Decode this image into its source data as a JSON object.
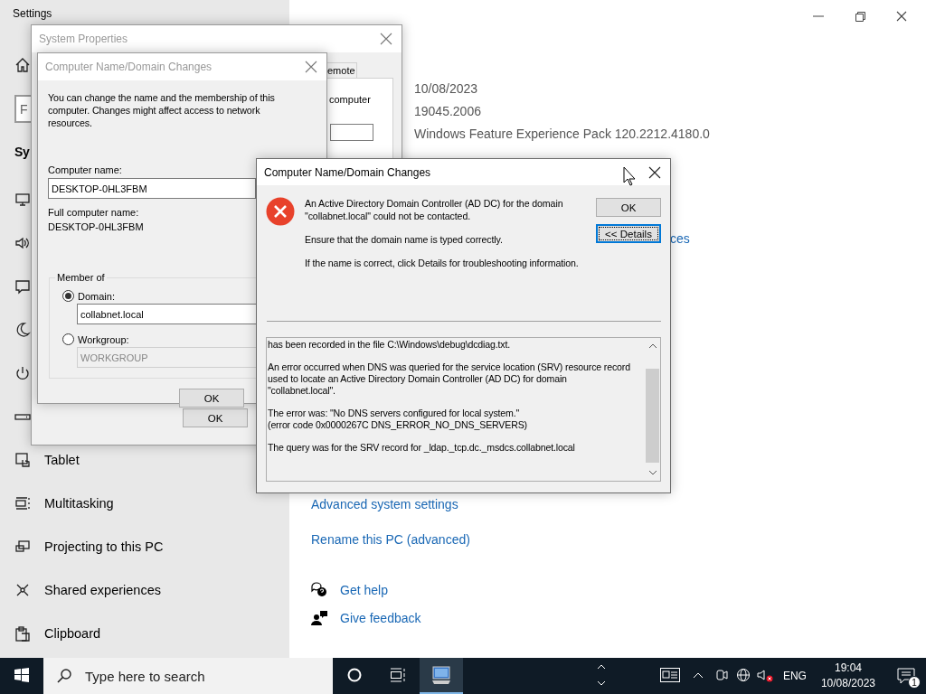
{
  "settings": {
    "title": "Settings"
  },
  "sidebar": {
    "search": {
      "placeholder": "F"
    },
    "heading": "Sy",
    "items": [
      {
        "kind": "display"
      },
      {
        "kind": "sound"
      },
      {
        "kind": "notifications"
      },
      {
        "kind": "focus"
      },
      {
        "kind": "power"
      },
      {
        "kind": "storage"
      },
      {
        "kind": "tablet",
        "label": "Tablet"
      },
      {
        "kind": "multitasking",
        "label": "Multitasking"
      },
      {
        "kind": "projecting",
        "label": "Projecting to this PC"
      },
      {
        "kind": "shared",
        "label": "Shared experiences"
      },
      {
        "kind": "clipboard",
        "label": "Clipboard"
      }
    ]
  },
  "about": {
    "values": [
      "10/08/2023",
      "19045.2006",
      "Windows Feature Experience Pack 120.2212.4180.0"
    ],
    "partial_link": "ces",
    "links": [
      "Advanced system settings",
      "Rename this PC (advanced)"
    ],
    "help": [
      {
        "kind": "help",
        "label": "Get help"
      },
      {
        "kind": "feedback",
        "label": "Give feedback"
      }
    ]
  },
  "system_properties": {
    "title": "System Properties",
    "active": false,
    "tab": "emote",
    "text": "computer",
    "button": "OK"
  },
  "name_dialog": {
    "title": "Computer Name/Domain Changes",
    "active": false,
    "intro": "You can change the name and the membership of this computer. Changes might affect access to network resources.",
    "computer_name_label": "Computer name:",
    "computer_name": "DESKTOP-0HL3FBM",
    "full_name_label": "Full computer name:",
    "full_name": "DESKTOP-0HL3FBM",
    "member_of": {
      "label": "Member of",
      "options": [
        {
          "label": "Domain:",
          "selected": true,
          "value": "collabnet.local",
          "disabled": false
        },
        {
          "label": "Workgroup:",
          "selected": false,
          "value": "WORKGROUP",
          "disabled": true
        }
      ]
    },
    "button": "OK"
  },
  "error_dialog": {
    "title": "Computer Name/Domain Changes",
    "active": true,
    "messages": [
      [
        "An Active Directory Domain Controller (AD DC) for the domain",
        "\"collabnet.local\" could not be contacted."
      ],
      [
        "Ensure that the domain name is typed correctly."
      ],
      [
        "If the name is correct, click Details for troubleshooting information."
      ]
    ],
    "buttons": [
      {
        "label": "OK",
        "focused": false
      },
      {
        "label": "<< Details",
        "focused": true
      }
    ],
    "details": [
      [
        "has been recorded in the file C:\\Windows\\debug\\dcdiag.txt."
      ],
      [
        "An error occurred when DNS was queried for the service location (SRV) resource record",
        "used to locate an Active Directory Domain Controller (AD DC) for domain",
        "\"collabnet.local\"."
      ],
      [
        "The error was: \"No DNS servers configured for local system.\"",
        "(error code 0x0000267C DNS_ERROR_NO_DNS_SERVERS)"
      ],
      [
        "The query was for the SRV record for _ldap._tcp.dc._msdcs.collabnet.local"
      ]
    ]
  },
  "taskbar": {
    "search_placeholder": "Type here to search",
    "apps": [
      {
        "kind": "system",
        "selected": true
      }
    ],
    "language": "ENG",
    "time": "19:04",
    "date": "10/08/2023",
    "notification_count": "1"
  }
}
